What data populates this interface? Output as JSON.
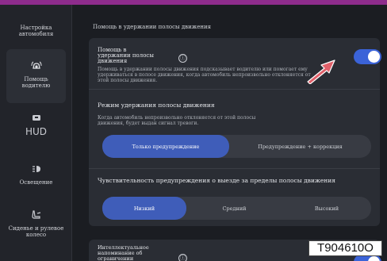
{
  "sidebar": {
    "items": [
      {
        "label": "Настройка автомобиля",
        "icon": "car-settings-icon"
      },
      {
        "label": "Помощь водителю",
        "icon": "driver-assist-icon"
      },
      {
        "label": "HUD",
        "icon": "hud-icon"
      },
      {
        "label": "Освещение",
        "icon": "headlight-icon"
      },
      {
        "label": "Сиденье и рулевое колесо",
        "icon": "seat-icon"
      }
    ]
  },
  "header": {
    "title": "Помощь в удержании полосы движения"
  },
  "lane_assist": {
    "title": "Помощь в удержании полосы движения",
    "info_icon": "ⓘ",
    "description": "Помощь в удержании полосы движения подсказывает водителю или помогает ему удерживаться в полосе движения, когда автомобиль непроизвольно отклоняется от этой полосы движения.",
    "enabled": true
  },
  "mode": {
    "title": "Режим удержания полосы движения",
    "description": "Когда автомобиль непроизвольно отклоняется от этой полосы движения, будет выдан сигнал тревоги.",
    "options": [
      "Только предупреждение",
      "Предупреждение + коррекция"
    ],
    "selected": "Только предупреждение"
  },
  "sensitivity": {
    "title": "Чувствительность предупреждения о выезде за пределы полосы движения",
    "options": [
      "Низкий",
      "Средний",
      "Высокий"
    ],
    "selected": "Низкий"
  },
  "speed_limit": {
    "title": "Интеллектуальное напоминание об ограничении скорости",
    "enabled": true
  },
  "watermark": "T904610O",
  "colors": {
    "accent": "#3b63d8",
    "segment_selected": "#3f5db9",
    "arrow": "#e0606a",
    "topbar": "#8e2c8c"
  }
}
